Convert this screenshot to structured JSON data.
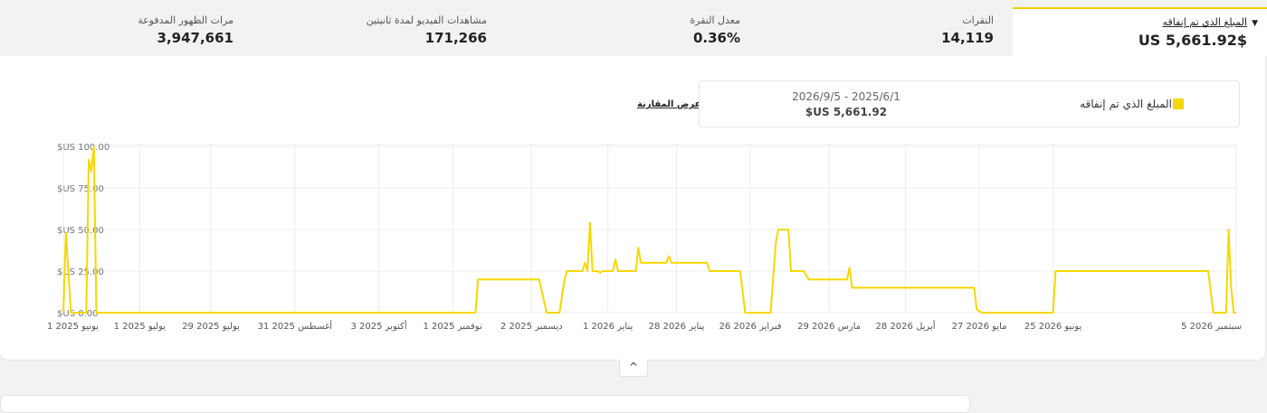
{
  "metrics": [
    {
      "label": "المبلغ الذي تم إنفاقه",
      "value": "$US 5,661.92"
    },
    {
      "label": "النقرات",
      "value": "14,119"
    },
    {
      "label": "معدل النقرة",
      "value": "0.36%"
    },
    {
      "label": "مشاهدات الفيديو لمدة ثانيتين",
      "value": "171,266"
    },
    {
      "label": "مرات الظهور المدفوعة",
      "value": "3,947,661"
    }
  ],
  "icons": {
    "dropdown": "caret-down-icon",
    "collapse": "chevron-up-icon"
  },
  "compare_label": "عرض المقارنة",
  "legend": {
    "series_name": "المبلغ الذي تم إنفاقه",
    "date_range": "2026/9/5 - 2025/6/1",
    "total": "$US 5,661.92"
  },
  "colors": {
    "accent": "#f5d800",
    "line": "#f5d800",
    "grid": "#ececec"
  },
  "chart_data": {
    "type": "line",
    "title": "",
    "xlabel": "",
    "ylabel": "",
    "x_start": "2025-06-01",
    "x_end": "2026-09-05",
    "ylim": [
      0,
      100
    ],
    "y_ticks": [
      {
        "value": 0,
        "label": "$US 0.00"
      },
      {
        "value": 25,
        "label": "$US 25.00"
      },
      {
        "value": 50,
        "label": "$US 50.00"
      },
      {
        "value": 75,
        "label": "$US 75.00"
      },
      {
        "value": 100,
        "label": "$US 100.00"
      }
    ],
    "x_ticks": [
      {
        "date": "2025-06-01",
        "label": "1 يونيو 2025"
      },
      {
        "date": "2025-07-01",
        "label": "1 يوليو 2025"
      },
      {
        "date": "2025-07-29",
        "label": "29 يوليو 2025"
      },
      {
        "date": "2025-08-31",
        "label": "31 أغسطس 2025"
      },
      {
        "date": "2025-10-03",
        "label": "3 أكتوبر 2025"
      },
      {
        "date": "2025-11-01",
        "label": "1 نوفمبر 2025"
      },
      {
        "date": "2025-12-02",
        "label": "2 ديسمبر 2025"
      },
      {
        "date": "2026-01-01",
        "label": "1 يناير 2026"
      },
      {
        "date": "2026-01-28",
        "label": "28 يناير 2026"
      },
      {
        "date": "2026-02-26",
        "label": "26 فبراير 2026"
      },
      {
        "date": "2026-03-29",
        "label": "29 مارس 2026"
      },
      {
        "date": "2026-04-28",
        "label": "28 أبريل 2026"
      },
      {
        "date": "2026-05-27",
        "label": "27 مايو 2026"
      },
      {
        "date": "2026-06-25",
        "label": "25 يونيو 2026"
      },
      {
        "date": "2026-09-05",
        "label": "5 سبتمبر 2026"
      }
    ],
    "series": [
      {
        "name": "المبلغ الذي تم إنفاقه",
        "points": [
          [
            "2025-06-01",
            0
          ],
          [
            "2025-06-02",
            48
          ],
          [
            "2025-06-04",
            0
          ],
          [
            "2025-06-10",
            0
          ],
          [
            "2025-06-11",
            92
          ],
          [
            "2025-06-12",
            85
          ],
          [
            "2025-06-13",
            100
          ],
          [
            "2025-06-14",
            0
          ],
          [
            "2025-11-10",
            0
          ],
          [
            "2025-11-11",
            20
          ],
          [
            "2025-12-05",
            20
          ],
          [
            "2025-12-08",
            0
          ],
          [
            "2025-12-13",
            0
          ],
          [
            "2025-12-15",
            20
          ],
          [
            "2025-12-16",
            25
          ],
          [
            "2025-12-22",
            25
          ],
          [
            "2025-12-23",
            30
          ],
          [
            "2025-12-24",
            25
          ],
          [
            "2025-12-25",
            54
          ],
          [
            "2025-12-26",
            25
          ],
          [
            "2025-12-28",
            25
          ],
          [
            "2025-12-29",
            24
          ],
          [
            "2025-12-30",
            25
          ],
          [
            "2026-01-03",
            25
          ],
          [
            "2026-01-04",
            32
          ],
          [
            "2026-01-05",
            25
          ],
          [
            "2026-01-12",
            25
          ],
          [
            "2026-01-13",
            39
          ],
          [
            "2026-01-14",
            30
          ],
          [
            "2026-01-24",
            30
          ],
          [
            "2026-01-25",
            34
          ],
          [
            "2026-01-26",
            30
          ],
          [
            "2026-02-09",
            30
          ],
          [
            "2026-02-10",
            25
          ],
          [
            "2026-02-22",
            25
          ],
          [
            "2026-02-24",
            0
          ],
          [
            "2026-03-06",
            0
          ],
          [
            "2026-03-08",
            42
          ],
          [
            "2026-03-09",
            50
          ],
          [
            "2026-03-13",
            50
          ],
          [
            "2026-03-14",
            25
          ],
          [
            "2026-03-19",
            25
          ],
          [
            "2026-03-21",
            20
          ],
          [
            "2026-04-01",
            20
          ],
          [
            "2026-04-02",
            20
          ],
          [
            "2026-04-05",
            20
          ],
          [
            "2026-04-06",
            27
          ],
          [
            "2026-04-07",
            15
          ],
          [
            "2026-05-25",
            15
          ],
          [
            "2026-05-26",
            2
          ],
          [
            "2026-05-28",
            0
          ],
          [
            "2026-06-25",
            0
          ],
          [
            "2026-06-26",
            25
          ],
          [
            "2026-08-25",
            25
          ],
          [
            "2026-08-27",
            0
          ],
          [
            "2026-09-01",
            0
          ],
          [
            "2026-09-02",
            50
          ],
          [
            "2026-09-03",
            15
          ],
          [
            "2026-09-04",
            0
          ]
        ]
      }
    ]
  }
}
